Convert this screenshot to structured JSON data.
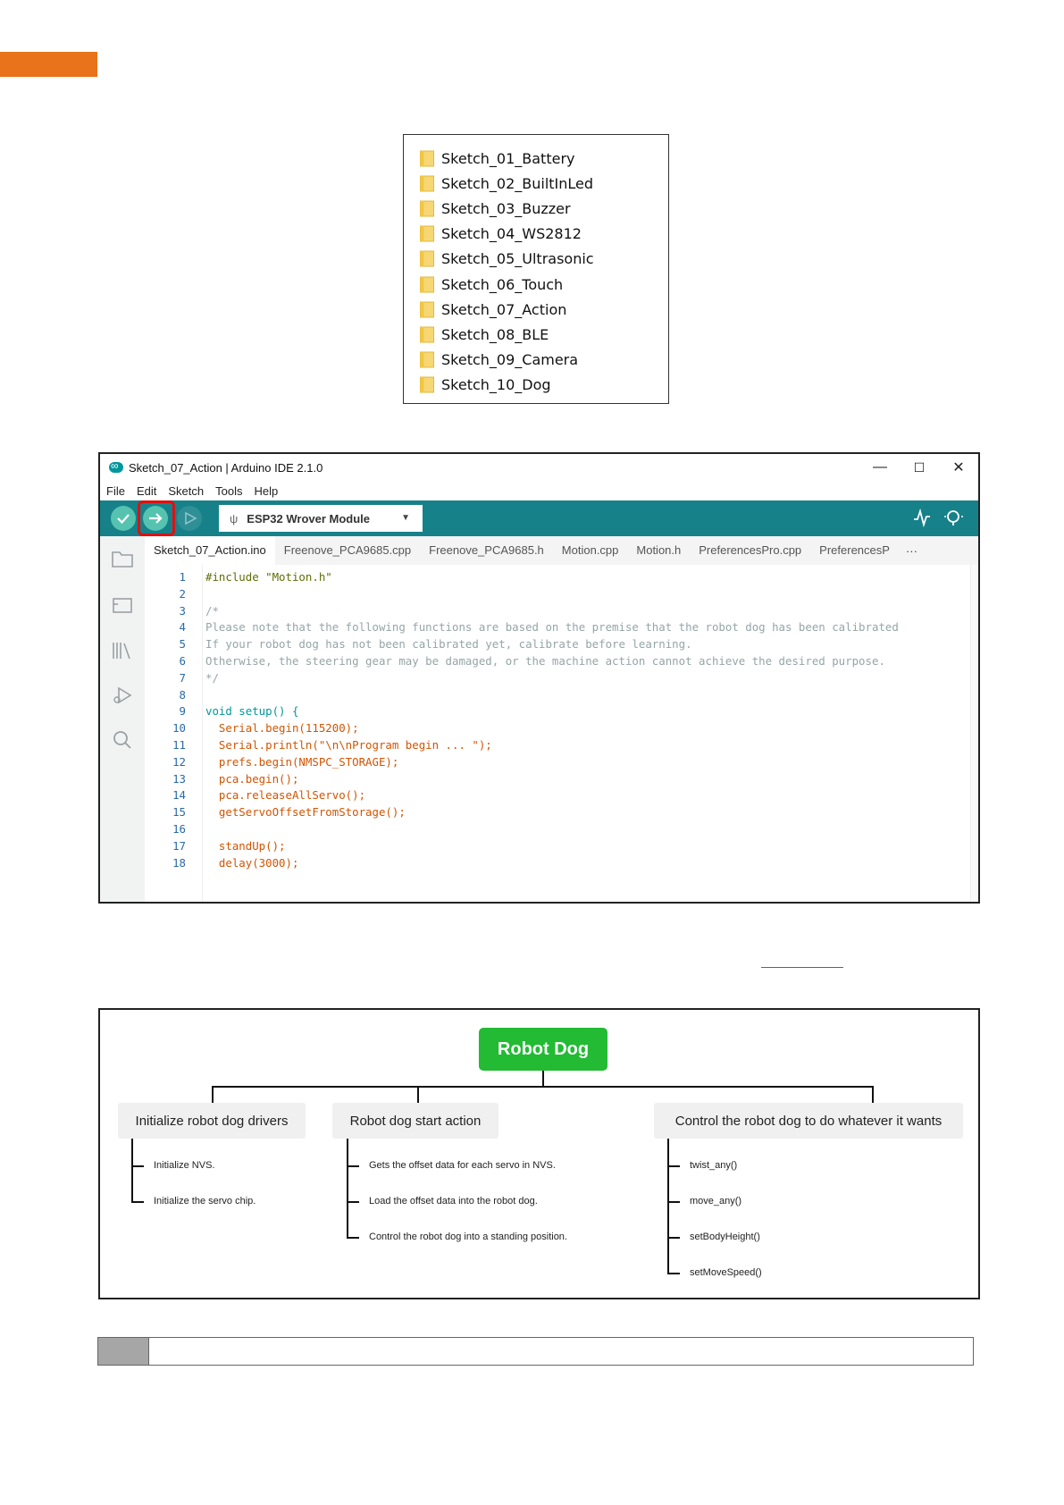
{
  "folders": [
    "Sketch_01_Battery",
    "Sketch_02_BuiltInLed",
    "Sketch_03_Buzzer",
    "Sketch_04_WS2812",
    "Sketch_05_Ultrasonic",
    "Sketch_06_Touch",
    "Sketch_07_Action",
    "Sketch_08_BLE",
    "Sketch_09_Camera",
    "Sketch_10_Dog"
  ],
  "ide": {
    "title": "Sketch_07_Action | Arduino IDE 2.1.0",
    "window_controls": {
      "minimize": "—",
      "maximize": "☐",
      "close": "✕"
    },
    "menu": [
      "File",
      "Edit",
      "Sketch",
      "Tools",
      "Help"
    ],
    "board": "ESP32 Wrover Module",
    "tabs": [
      "Sketch_07_Action.ino",
      "Freenove_PCA9685.cpp",
      "Freenove_PCA9685.h",
      "Motion.cpp",
      "Motion.h",
      "PreferencesPro.cpp",
      "PreferencesP"
    ],
    "tab_more": "···",
    "code": [
      {
        "n": "1",
        "t": "#include \"Motion.h\""
      },
      {
        "n": "2",
        "t": ""
      },
      {
        "n": "3",
        "t": "/*"
      },
      {
        "n": "4",
        "t": "Please note that the following functions are based on the premise that the robot dog has been calibrated"
      },
      {
        "n": "5",
        "t": "If your robot dog has not been calibrated yet, calibrate before learning."
      },
      {
        "n": "6",
        "t": "Otherwise, the steering gear may be damaged, or the machine action cannot achieve the desired purpose."
      },
      {
        "n": "7",
        "t": "*/"
      },
      {
        "n": "8",
        "t": ""
      },
      {
        "n": "9",
        "t": "void setup() {"
      },
      {
        "n": "10",
        "t": "  Serial.begin(115200);"
      },
      {
        "n": "11",
        "t": "  Serial.println(\"\\n\\nProgram begin ... \");"
      },
      {
        "n": "12",
        "t": "  prefs.begin(NMSPC_STORAGE);"
      },
      {
        "n": "13",
        "t": "  pca.begin();"
      },
      {
        "n": "14",
        "t": "  pca.releaseAllServo();"
      },
      {
        "n": "15",
        "t": "  getServoOffsetFromStorage();"
      },
      {
        "n": "16",
        "t": ""
      },
      {
        "n": "17",
        "t": "  standUp();"
      },
      {
        "n": "18",
        "t": "  delay(3000);"
      }
    ]
  },
  "diagram": {
    "root": "Robot Dog",
    "branches": [
      {
        "label": "Initialize robot dog drivers",
        "leaves": [
          "Initialize NVS.",
          "Initialize the servo chip."
        ]
      },
      {
        "label": "Robot dog start action",
        "leaves": [
          "Gets the offset data for each servo in NVS.",
          "Load the offset data into the robot dog.",
          "Control the robot dog into a standing position."
        ]
      },
      {
        "label": "Control the robot dog to do whatever it wants",
        "leaves": [
          "twist_any()",
          "move_any()",
          "setBodyHeight()",
          "setMoveSpeed()"
        ]
      }
    ]
  }
}
